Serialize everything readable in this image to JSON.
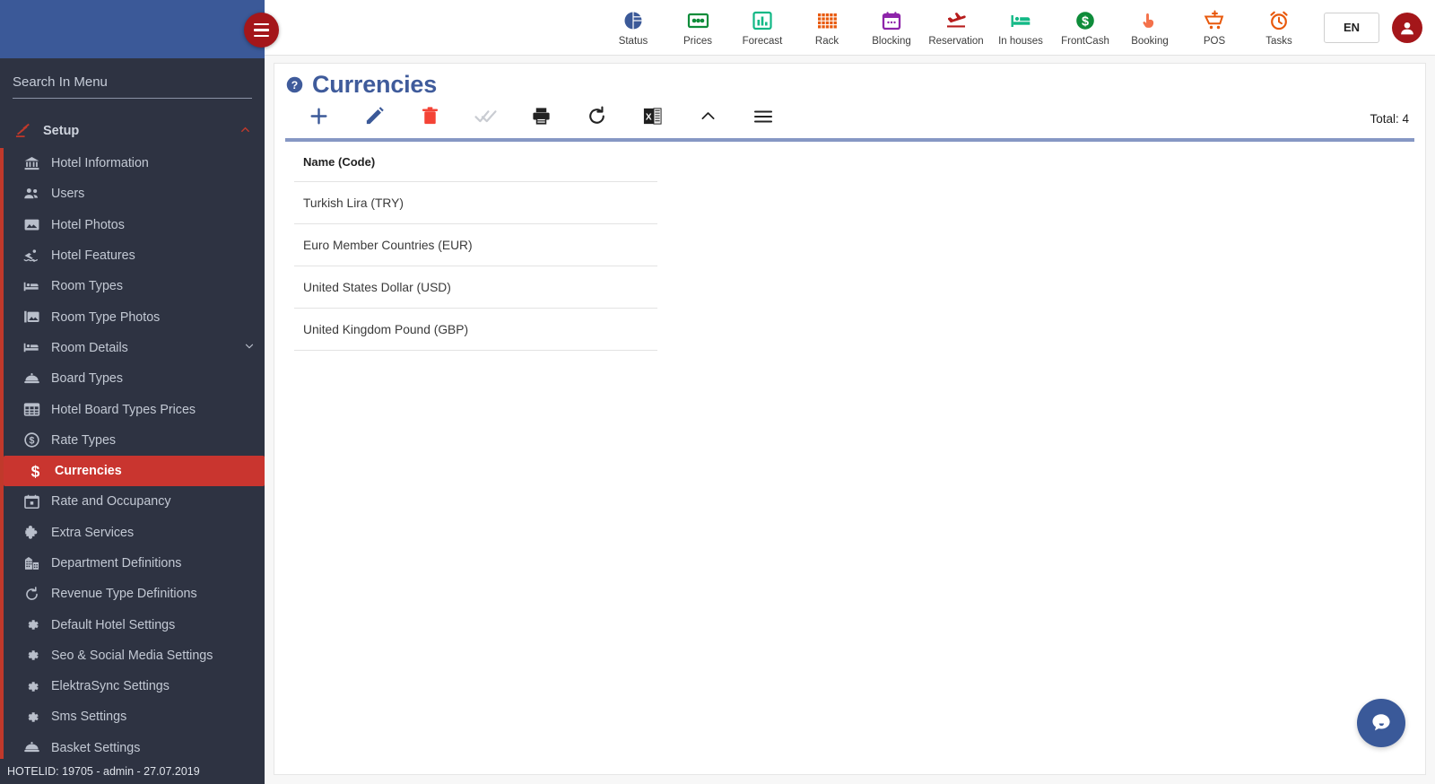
{
  "topnav": {
    "items": [
      {
        "label": "Status",
        "icon": "pie-chart-icon",
        "color": "#3b5998"
      },
      {
        "label": "Prices",
        "icon": "money-bill-icon",
        "color": "#0e8c3a"
      },
      {
        "label": "Forecast",
        "icon": "bar-chart-icon",
        "color": "#12b886"
      },
      {
        "label": "Rack",
        "icon": "grid-icon",
        "color": "#e8590c"
      },
      {
        "label": "Blocking",
        "icon": "calendar-icon",
        "color": "#8e24aa"
      },
      {
        "label": "Reservation",
        "icon": "plane-arrival-icon",
        "color": "#b71c1c"
      },
      {
        "label": "In houses",
        "icon": "bed-icon",
        "color": "#12b886"
      },
      {
        "label": "FrontCash",
        "icon": "dollar-circle-icon",
        "color": "#0e8c3a"
      },
      {
        "label": "Booking",
        "icon": "hand-pointer-icon",
        "color": "#f4714a"
      },
      {
        "label": "POS",
        "icon": "cart-plus-icon",
        "color": "#e8590c"
      },
      {
        "label": "Tasks",
        "icon": "alarm-clock-icon",
        "color": "#e8590c"
      }
    ],
    "language": "EN",
    "avatar_icon": "user-circle-icon"
  },
  "sidebar": {
    "search_placeholder": "Search In Menu",
    "group": {
      "label": "Setup",
      "icon": "tools-icon",
      "chevron": "chevron-up-icon"
    },
    "items": [
      {
        "label": "Hotel Information",
        "icon": "bank-icon",
        "active": false,
        "chevron": ""
      },
      {
        "label": "Users",
        "icon": "users-icon",
        "active": false,
        "chevron": ""
      },
      {
        "label": "Hotel Photos",
        "icon": "image-icon",
        "active": false,
        "chevron": ""
      },
      {
        "label": "Hotel Features",
        "icon": "swimmer-icon",
        "active": false,
        "chevron": ""
      },
      {
        "label": "Room Types",
        "icon": "bed-icon",
        "active": false,
        "chevron": ""
      },
      {
        "label": "Room Type Photos",
        "icon": "images-icon",
        "active": false,
        "chevron": ""
      },
      {
        "label": "Room Details",
        "icon": "bed-icon",
        "active": false,
        "chevron": "chevron-down-icon"
      },
      {
        "label": "Board Types",
        "icon": "tray-icon",
        "active": false,
        "chevron": ""
      },
      {
        "label": "Hotel Board Types Prices",
        "icon": "table-icon",
        "active": false,
        "chevron": ""
      },
      {
        "label": "Rate Types",
        "icon": "dollar-circle-icon",
        "active": false,
        "chevron": ""
      },
      {
        "label": "Currencies",
        "icon": "dollar-sign-icon",
        "active": true,
        "chevron": ""
      },
      {
        "label": "Rate and Occupancy",
        "icon": "calendar-icon",
        "active": false,
        "chevron": ""
      },
      {
        "label": "Extra Services",
        "icon": "puzzle-icon",
        "active": false,
        "chevron": ""
      },
      {
        "label": "Department Definitions",
        "icon": "building-icon",
        "active": false,
        "chevron": ""
      },
      {
        "label": "Revenue Type Definitions",
        "icon": "refresh-icon",
        "active": false,
        "chevron": ""
      },
      {
        "label": "Default Hotel Settings",
        "icon": "gear-icon",
        "active": false,
        "chevron": ""
      },
      {
        "label": "Seo & Social Media Settings",
        "icon": "gear-icon",
        "active": false,
        "chevron": ""
      },
      {
        "label": "ElektraSync Settings",
        "icon": "gear-icon",
        "active": false,
        "chevron": ""
      },
      {
        "label": "Sms Settings",
        "icon": "gear-icon",
        "active": false,
        "chevron": ""
      },
      {
        "label": "Basket Settings",
        "icon": "tray-icon",
        "active": false,
        "chevron": ""
      }
    ],
    "status_text": "HOTELID: 19705 - admin - 27.07.2019"
  },
  "page": {
    "title": "Currencies",
    "help_icon": "question-circle-icon",
    "toolbar": {
      "buttons": [
        {
          "name": "add",
          "icon": "plus-icon",
          "color": "#3b5998"
        },
        {
          "name": "edit",
          "icon": "pencil-icon",
          "color": "#3b5998"
        },
        {
          "name": "delete",
          "icon": "trash-icon",
          "color": "#f44336"
        },
        {
          "name": "approve",
          "icon": "double-check-icon",
          "color": "#c9ccd2"
        },
        {
          "name": "print",
          "icon": "printer-icon",
          "color": "#232323"
        },
        {
          "name": "refresh",
          "icon": "refresh-icon",
          "color": "#232323"
        },
        {
          "name": "excel",
          "icon": "excel-icon",
          "color": "#1d6f42"
        },
        {
          "name": "collapse",
          "icon": "chevron-up-icon",
          "color": "#232323"
        },
        {
          "name": "menu",
          "icon": "hamburger-icon",
          "color": "#232323"
        }
      ],
      "total_label": "Total: 4"
    },
    "table": {
      "columns": [
        "Name (Code)"
      ],
      "rows": [
        [
          "Turkish Lira (TRY)"
        ],
        [
          "Euro Member Countries (EUR)"
        ],
        [
          "United States Dollar (USD)"
        ],
        [
          "United Kingdom Pound (GBP)"
        ]
      ]
    }
  },
  "chat": {
    "icon": "chat-bubble-icon",
    "color": "#3a5999"
  }
}
